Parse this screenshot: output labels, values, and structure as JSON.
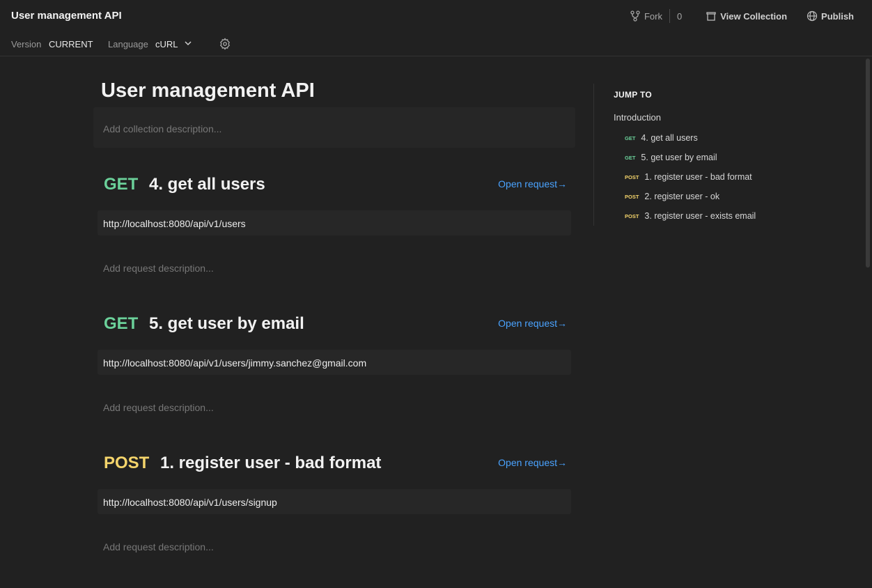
{
  "app": {
    "title": "User management API"
  },
  "actions": {
    "fork_label": "Fork",
    "fork_count": "0",
    "view_collection": "View Collection",
    "publish": "Publish"
  },
  "subbar": {
    "version_label": "Version",
    "version_value": "CURRENT",
    "language_label": "Language",
    "language_value": "cURL"
  },
  "doc": {
    "title": "User management API",
    "description_placeholder": "Add collection description..."
  },
  "requests": [
    {
      "method": "GET",
      "name": "4. get all users",
      "open": "Open request→",
      "url": "http://localhost:8080/api/v1/users",
      "desc": "Add request description..."
    },
    {
      "method": "GET",
      "name": "5. get user by email",
      "open": "Open request→",
      "url": "http://localhost:8080/api/v1/users/jimmy.sanchez@gmail.com",
      "desc": "Add request description..."
    },
    {
      "method": "POST",
      "name": "1. register user - bad format",
      "open": "Open request→",
      "url": "http://localhost:8080/api/v1/users/signup",
      "desc": "Add request description..."
    }
  ],
  "jump_to": {
    "title": "JUMP TO",
    "intro": "Introduction",
    "items": [
      {
        "method": "GET",
        "label": "4. get all users"
      },
      {
        "method": "GET",
        "label": "5. get user by email"
      },
      {
        "method": "POST",
        "label": "1. register user - bad format"
      },
      {
        "method": "POST",
        "label": "2. register user - ok"
      },
      {
        "method": "POST",
        "label": "3. register user - exists email"
      }
    ]
  },
  "colors": {
    "background": "#212121",
    "get": "#6bd19a",
    "post": "#f4d46b",
    "link": "#4aa3ff"
  }
}
